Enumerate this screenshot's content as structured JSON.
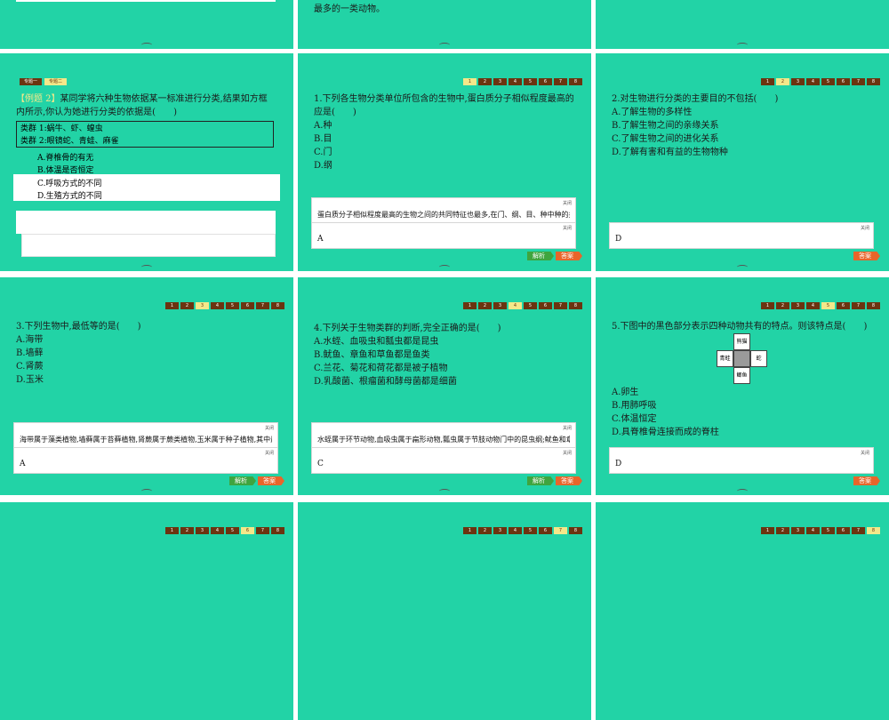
{
  "top_row": {
    "middle_fragment": "最多的一类动物。"
  },
  "slide_example": {
    "tags": [
      "专题一",
      "专题二"
    ],
    "example_label": "【例题 2】",
    "question": "某同学将六种生物依据某一标准进行分类,结果如方框内所示,你认为她进行分类的依据是(　　)",
    "box_lines": [
      "类群 1:蜗牛、虾、蝗虫",
      "类群 2:眼镜蛇、青蛙、麻雀"
    ],
    "options": [
      "A.脊椎骨的有无",
      "B.体温是否恒定",
      "C.呼吸方式的不同",
      "D.生殖方式的不同"
    ]
  },
  "nav": [
    "1",
    "2",
    "3",
    "4",
    "5",
    "6",
    "7",
    "8"
  ],
  "close_label": "关闭",
  "buttons": {
    "analysis": "解析",
    "answer": "答案"
  },
  "q1": {
    "text": "1.下列各生物分类单位所包含的生物中,蛋白质分子相似程度最高的应是(　　)",
    "options": [
      "A.种",
      "B.目",
      "C.门",
      "D.纲"
    ],
    "explanation": "蛋白质分子相似程度最高的生物之间的共同特征也最多,在门、纲、目、种中种的共同特征最多,故其蛋白质分子相似程度最高。",
    "answer": "A"
  },
  "q2": {
    "text": "2.对生物进行分类的主要目的不包括(　　)",
    "options": [
      "A.了解生物的多样性",
      "B.了解生物之间的亲缘关系",
      "C.了解生物之间的进化关系",
      "D.了解有害和有益的生物物种"
    ],
    "answer": "D"
  },
  "q3": {
    "text": "3.下列生物中,最低等的是(　　)",
    "options": [
      "A.海带",
      "B.墙藓",
      "C.肾蕨",
      "D.玉米"
    ],
    "explanation": "海带属于藻类植物,墙藓属于苔藓植物,肾蕨属于蕨类植物,玉米属于种子植物,其中最低等的是海带。",
    "answer": "A"
  },
  "q4": {
    "text": "4.下列关于生物类群的判断,完全正确的是(　　)",
    "options": [
      "A.水蛭、血吸虫和瓢虫都是昆虫",
      "B.鱿鱼、章鱼和草鱼都是鱼类",
      "C.兰花、菊花和荷花都是被子植物",
      "D.乳酸菌、根瘤菌和酵母菌都是细菌"
    ],
    "explanation": "水蛭属于环节动物,血吸虫属于扁形动物,瓢虫属于节肢动物门中的昆虫纲;鱿鱼和章鱼属于软体动物,草鱼属于鱼类。",
    "answer": "C"
  },
  "q5": {
    "text": "5.下图中的黑色部分表示四种动物共有的特点。则该特点是(　　)",
    "figure": {
      "top": "熊猫",
      "left": "青蛙",
      "right": "蛇",
      "bottom": "鲫鱼"
    },
    "options": [
      "A.卵生",
      "B.用肺呼吸",
      "C.体温恒定",
      "D.具脊椎骨连接而成的脊柱"
    ],
    "answer": "D"
  },
  "colors": {
    "slide_bg": "#22d3a6",
    "nav_dark": "#6b3410",
    "nav_active": "#f4e88a",
    "analysis_btn": "#3fa53f",
    "answer_btn": "#e8652a"
  }
}
